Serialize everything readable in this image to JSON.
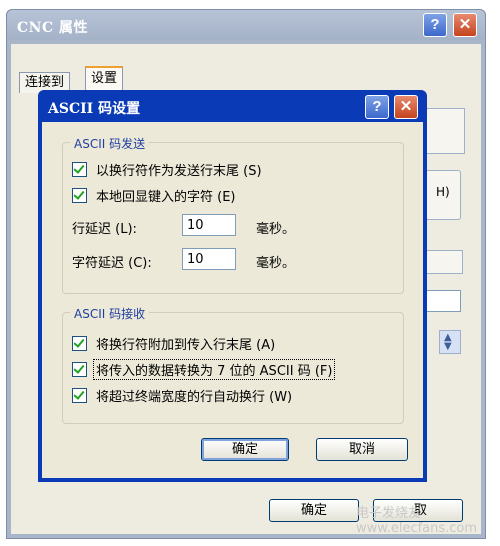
{
  "outer_window": {
    "title": "CNC 属性",
    "help_glyph": "?",
    "close_glyph": "✕",
    "tabs": [
      {
        "label": "连接到",
        "active": false
      },
      {
        "label": "设置",
        "active": true
      }
    ],
    "partial_button_text": "H)",
    "ok_label": "确定",
    "cancel_label_partial": "取"
  },
  "dialog": {
    "title": "ASCII 码设置",
    "help_glyph": "?",
    "close_glyph": "✕",
    "send_group": {
      "label": "ASCII 码发送",
      "options": [
        {
          "label": "以换行符作为发送行末尾 (S)",
          "checked": true
        },
        {
          "label": "本地回显键入的字符 (E)",
          "checked": true
        }
      ],
      "line_delay_label": "行延迟 (L):",
      "line_delay_value": "10",
      "line_delay_unit": "毫秒。",
      "char_delay_label": "字符延迟 (C):",
      "char_delay_value": "10",
      "char_delay_unit": "毫秒。"
    },
    "receive_group": {
      "label": "ASCII 码接收",
      "options": [
        {
          "label": "将换行符附加到传入行末尾 (A)",
          "checked": true
        },
        {
          "label": "将传入的数据转换为 7 位的 ASCII 码 (F)",
          "checked": true
        },
        {
          "label": "将超过终端宽度的行自动换行 (W)",
          "checked": true
        }
      ]
    },
    "ok_label": "确定",
    "cancel_label": "取消"
  },
  "watermark": "电子发烧友 www.elecfans.com",
  "colors": {
    "dialog_frame": "#0a3ab5",
    "dialog_face": "#ece9d8",
    "outer_frame_inactive": "#a9b6c9",
    "group_label": "#1f3fa0",
    "checkmark": "#21a121"
  }
}
